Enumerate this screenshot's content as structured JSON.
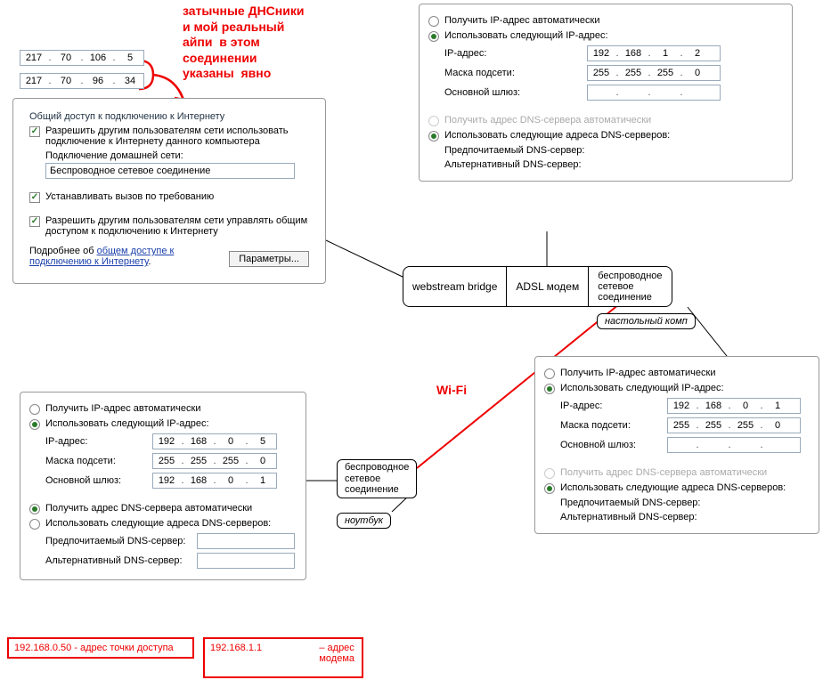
{
  "annotation_top": "затычные ДНСники\nи мой реальный\nайпи  в этом\nсоединении\nуказаны  явно",
  "dns_box": {
    "ip1": [
      "217",
      "70",
      "106",
      "5"
    ],
    "ip2": [
      "217",
      "70",
      "96",
      "34"
    ]
  },
  "ics_panel": {
    "group_title": "Общий доступ к подключению к Интернету",
    "chk1_label": "Разрешить другим пользователям сети использовать подключение к Интернету данного компьютера",
    "home_conn_label": "Подключение домашней сети:",
    "home_conn_value": "Беспроводное сетевое соединение",
    "chk2_label": "Устанавливать вызов по требованию",
    "chk3_label": "Разрешить другим пользователям сети управлять общим доступом к подключению к Интернету",
    "more_prefix": "Подробнее об ",
    "more_link": "общем доступе к подключению к Интернету",
    "more_suffix": ".",
    "btn_params": "Параметры..."
  },
  "panel_top_right": {
    "r1": "Получить IP-адрес автоматически",
    "r2": "Использовать следующий IP-адрес:",
    "ip_label": "IP-адрес:",
    "ip": [
      "192",
      "168",
      "1",
      "2"
    ],
    "mask_label": "Маска подсети:",
    "mask": [
      "255",
      "255",
      "255",
      "0"
    ],
    "gw_label": "Основной шлюз:",
    "gw": [
      "",
      "",
      "",
      ""
    ],
    "r3": "Получить адрес DNS-сервера автоматически",
    "r4": "Использовать следующие адреса DNS-серверов:",
    "dns1_label": "Предпочитаемый DNS-сервер:",
    "dns2_label": "Альтернативный DNS-сервер:"
  },
  "tabs": {
    "t1": "webstream bridge",
    "t2": "ADSL модем",
    "t3": "беcпроводное\nсетевое\nсоединение"
  },
  "desktop_label": "настольный комп",
  "panel_mid_right": {
    "r1": "Получить IP-адрес автоматически",
    "r2": "Использовать следующий IP-адрес:",
    "ip_label": "IP-адрес:",
    "ip": [
      "192",
      "168",
      "0",
      "1"
    ],
    "mask_label": "Маска подсети:",
    "mask": [
      "255",
      "255",
      "255",
      "0"
    ],
    "gw_label": "Основной шлюз:",
    "gw": [
      "",
      "",
      "",
      ""
    ],
    "r3": "Получить адрес DNS-сервера автоматически",
    "r4": "Использовать следующие адреса DNS-серверов:",
    "dns1_label": "Предпочитаемый DNS-сервер:",
    "dns2_label": "Альтернативный DNS-сервер:"
  },
  "wifi_label": "Wi-Fi",
  "wireless_box_label": "беспроводное\nсетевое\nсоединение",
  "notebook_label": "ноутбук",
  "panel_bottom_left": {
    "r1": "Получить IP-адрес автоматически",
    "r2": "Использовать следующий IP-адрес:",
    "ip_label": "IP-адрес:",
    "ip": [
      "192",
      "168",
      "0",
      "5"
    ],
    "mask_label": "Маска подсети:",
    "mask": [
      "255",
      "255",
      "255",
      "0"
    ],
    "gw_label": "Основной шлюз:",
    "gw": [
      "192",
      "168",
      "0",
      "1"
    ],
    "r3": "Получить адрес DNS-сервера автоматически",
    "r4": "Использовать следующие адреса DNS-серверов:",
    "dns1_label": "Предпочитаемый DNS-сервер:",
    "dns2_label": "Альтернативный DNS-сервер:"
  },
  "red_box_left": "192.168.0.50 - адрес точки доступа",
  "red_box_right_ip": "192.168.1.1",
  "red_box_right_note": "адрес\nмодема"
}
